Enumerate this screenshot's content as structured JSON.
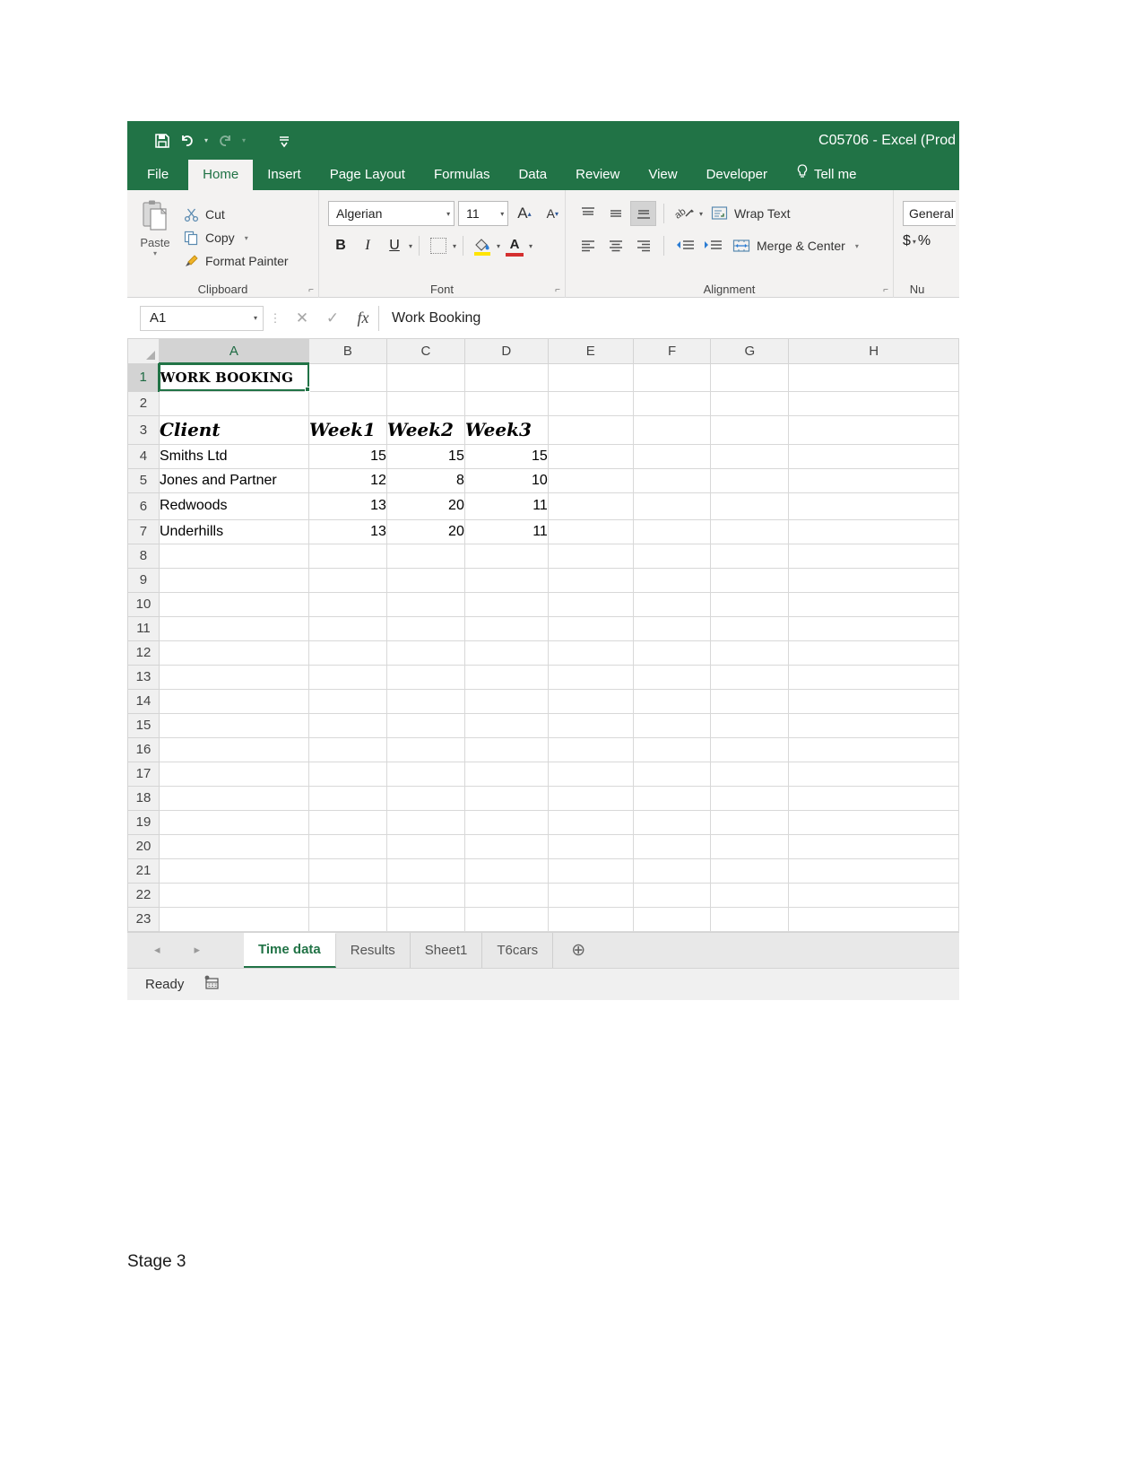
{
  "window": {
    "title": "C05706 - Excel (Prod",
    "quick_access": [
      {
        "name": "save-icon",
        "glyph": "ὋE"
      },
      {
        "name": "undo-icon",
        "glyph": "↶"
      },
      {
        "name": "redo-icon",
        "glyph": "↷"
      },
      {
        "name": "customize-quick-access-icon",
        "glyph": "≡"
      }
    ]
  },
  "ribbon": {
    "tabs": [
      {
        "label": "File",
        "active": false
      },
      {
        "label": "Home",
        "active": true
      },
      {
        "label": "Insert",
        "active": false
      },
      {
        "label": "Page Layout",
        "active": false
      },
      {
        "label": "Formulas",
        "active": false
      },
      {
        "label": "Data",
        "active": false
      },
      {
        "label": "Review",
        "active": false
      },
      {
        "label": "View",
        "active": false
      },
      {
        "label": "Developer",
        "active": false
      }
    ],
    "tell_me": "Tell me",
    "groups": {
      "clipboard": {
        "label": "Clipboard",
        "paste": "Paste",
        "cut": "Cut",
        "copy": "Copy",
        "format_painter": "Format Painter"
      },
      "font": {
        "label": "Font",
        "font_name": "Algerian",
        "font_size": "11",
        "bold": "B",
        "italic": "I",
        "underline": "U"
      },
      "alignment": {
        "label": "Alignment",
        "wrap_text": "Wrap Text",
        "merge_center": "Merge & Center"
      },
      "number": {
        "label": "Nu",
        "format": "General",
        "currency": "$",
        "percent": "%"
      }
    }
  },
  "formula_bar": {
    "name_box": "A1",
    "value": "Work Booking"
  },
  "grid": {
    "columns": [
      "A",
      "B",
      "C",
      "D",
      "E",
      "F",
      "G",
      "H"
    ],
    "selected_cell": "A1",
    "rows": [
      {
        "n": "1",
        "cells": [
          "WORK BOOKING",
          "",
          "",
          "",
          "",
          "",
          "",
          ""
        ]
      },
      {
        "n": "2",
        "cells": [
          "",
          "",
          "",
          "",
          "",
          "",
          "",
          ""
        ]
      },
      {
        "n": "3",
        "cells": [
          "Client",
          "Week1",
          "Week2",
          "Week3",
          "",
          "",
          "",
          ""
        ]
      },
      {
        "n": "4",
        "cells": [
          "Smiths Ltd",
          "15",
          "15",
          "15",
          "",
          "",
          "",
          ""
        ]
      },
      {
        "n": "5",
        "cells": [
          "Jones and Partner",
          "12",
          "8",
          "10",
          "",
          "",
          "",
          ""
        ]
      },
      {
        "n": "6",
        "cells": [
          "Redwoods",
          "13",
          "20",
          "11",
          "",
          "",
          "",
          ""
        ]
      },
      {
        "n": "7",
        "cells": [
          "Underhills",
          "13",
          "20",
          "11",
          "",
          "",
          "",
          ""
        ]
      },
      {
        "n": "8",
        "cells": [
          "",
          "",
          "",
          "",
          "",
          "",
          "",
          ""
        ]
      },
      {
        "n": "9",
        "cells": [
          "",
          "",
          "",
          "",
          "",
          "",
          "",
          ""
        ]
      },
      {
        "n": "10",
        "cells": [
          "",
          "",
          "",
          "",
          "",
          "",
          "",
          ""
        ]
      },
      {
        "n": "11",
        "cells": [
          "",
          "",
          "",
          "",
          "",
          "",
          "",
          ""
        ]
      },
      {
        "n": "12",
        "cells": [
          "",
          "",
          "",
          "",
          "",
          "",
          "",
          ""
        ]
      },
      {
        "n": "13",
        "cells": [
          "",
          "",
          "",
          "",
          "",
          "",
          "",
          ""
        ]
      },
      {
        "n": "14",
        "cells": [
          "",
          "",
          "",
          "",
          "",
          "",
          "",
          ""
        ]
      },
      {
        "n": "15",
        "cells": [
          "",
          "",
          "",
          "",
          "",
          "",
          "",
          ""
        ]
      },
      {
        "n": "16",
        "cells": [
          "",
          "",
          "",
          "",
          "",
          "",
          "",
          ""
        ]
      },
      {
        "n": "17",
        "cells": [
          "",
          "",
          "",
          "",
          "",
          "",
          "",
          ""
        ]
      },
      {
        "n": "18",
        "cells": [
          "",
          "",
          "",
          "",
          "",
          "",
          "",
          ""
        ]
      },
      {
        "n": "19",
        "cells": [
          "",
          "",
          "",
          "",
          "",
          "",
          "",
          ""
        ]
      },
      {
        "n": "20",
        "cells": [
          "",
          "",
          "",
          "",
          "",
          "",
          "",
          ""
        ]
      },
      {
        "n": "21",
        "cells": [
          "",
          "",
          "",
          "",
          "",
          "",
          "",
          ""
        ]
      },
      {
        "n": "22",
        "cells": [
          "",
          "",
          "",
          "",
          "",
          "",
          "",
          ""
        ]
      },
      {
        "n": "23",
        "cells": [
          "",
          "",
          "",
          "",
          "",
          "",
          "",
          ""
        ]
      }
    ]
  },
  "sheet_tabs": {
    "nav_prev": "◂",
    "nav_next": "▸",
    "tabs": [
      {
        "label": "Time data",
        "active": true
      },
      {
        "label": "Results",
        "active": false
      },
      {
        "label": "Sheet1",
        "active": false
      },
      {
        "label": "T6cars",
        "active": false
      }
    ],
    "add_sheet": "⊕"
  },
  "status_bar": {
    "mode": "Ready",
    "icon": "macro-record-icon"
  },
  "caption": "Stage 3",
  "colors": {
    "excel_green": "#217346",
    "ribbon_bg": "#f3f2f1",
    "grid_line": "#d8d8d8"
  }
}
